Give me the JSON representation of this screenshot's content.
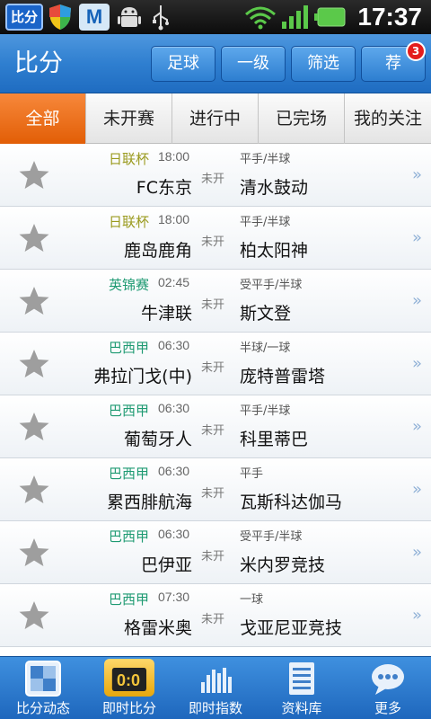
{
  "status_bar": {
    "app_icon_text": "比分",
    "time": "17:37"
  },
  "header": {
    "title": "比分",
    "buttons": [
      "足球",
      "一级",
      "筛选",
      "荐"
    ],
    "badge": "3"
  },
  "tabs": [
    "全部",
    "未开赛",
    "进行中",
    "已完场",
    "我的关注"
  ],
  "colors": {
    "league_japan": "#9a9a1e",
    "league_other": "#1e9a72",
    "accent": "#e25e06"
  },
  "matches": [
    {
      "league": "日联杯",
      "time": "18:00",
      "home": "FC东京",
      "status": "未开",
      "handicap": "平手/半球",
      "away": "清水鼓动"
    },
    {
      "league": "日联杯",
      "time": "18:00",
      "home": "鹿岛鹿角",
      "status": "未开",
      "handicap": "平手/半球",
      "away": "柏太阳神"
    },
    {
      "league": "英锦赛",
      "time": "02:45",
      "home": "牛津联",
      "status": "未开",
      "handicap": "受平手/半球",
      "away": "斯文登"
    },
    {
      "league": "巴西甲",
      "time": "06:30",
      "home": "弗拉门戈(中)",
      "status": "未开",
      "handicap": "半球/一球",
      "away": "庞特普雷塔"
    },
    {
      "league": "巴西甲",
      "time": "06:30",
      "home": "葡萄牙人",
      "status": "未开",
      "handicap": "平手/半球",
      "away": "科里蒂巴"
    },
    {
      "league": "巴西甲",
      "time": "06:30",
      "home": "累西腓航海",
      "status": "未开",
      "handicap": "平手",
      "away": "瓦斯科达伽马"
    },
    {
      "league": "巴西甲",
      "time": "06:30",
      "home": "巴伊亚",
      "status": "未开",
      "handicap": "受平手/半球",
      "away": "米内罗竞技"
    },
    {
      "league": "巴西甲",
      "time": "07:30",
      "home": "格雷米奥",
      "status": "未开",
      "handicap": "一球",
      "away": "戈亚尼亚竞技"
    }
  ],
  "bottom_nav": [
    "比分动态",
    "即时比分",
    "即时指数",
    "资料库",
    "更多"
  ],
  "bottom_nav_icons": [
    "score-dynamics-icon",
    "live-score-icon",
    "live-odds-icon",
    "database-icon",
    "more-icon"
  ],
  "live_score_icon_text": "0:0"
}
